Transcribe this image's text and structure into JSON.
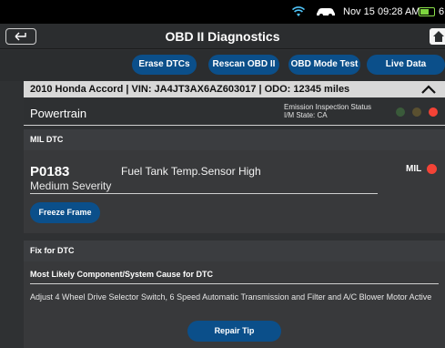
{
  "status_bar": {
    "date": "Nov 15",
    "time": "09:28 AM",
    "battery_text": "6",
    "battery_color": "#7ed63f"
  },
  "header": {
    "title": "OBD II Diagnostics",
    "back_icon": "back-arrow-icon",
    "home_icon": "home-icon"
  },
  "toolbar": {
    "buttons": [
      "Erase DTCs",
      "Rescan OBD II",
      "OBD Mode Test",
      "Live Data"
    ],
    "accent": "#0b4f8a"
  },
  "vehicle": {
    "info": "2010 Honda Accord | VIN: JA4JT3AX6AZ603017 | ODO: 12345 miles"
  },
  "powertrain": {
    "label": "Powertrain",
    "emission_status_label": "Emission Inspection Status",
    "state_label": "I/M State: CA",
    "indicators": [
      "#3a5a3a",
      "#5a5030",
      "#f44336"
    ]
  },
  "mil_dtc": {
    "section_label": "MIL DTC",
    "code": "P0183",
    "description": "Fuel Tank Temp.Sensor High",
    "severity": "Medium Severity",
    "mil_label": "MIL",
    "mil_color": "#f44336",
    "freeze_frame_label": "Freeze Frame"
  },
  "fix": {
    "section_label": "Fix for DTC",
    "cause_heading": "Most Likely Component/System Cause for DTC",
    "cause_text": "Adjust 4 Wheel Drive Selector Switch, 6 Speed Automatic Transmission and Filter and A/C Blower Motor Active",
    "repair_tip_label": "Repair Tip"
  }
}
